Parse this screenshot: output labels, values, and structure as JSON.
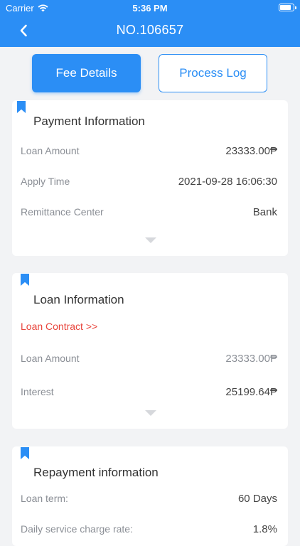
{
  "status_bar": {
    "carrier": "Carrier",
    "time": "5:36 PM"
  },
  "nav": {
    "title": "NO.106657"
  },
  "tabs": {
    "fee_details": "Fee Details",
    "process_log": "Process Log"
  },
  "payment_info": {
    "title": "Payment Information",
    "rows": [
      {
        "label": "Loan Amount",
        "value": "23333.00₱"
      },
      {
        "label": "Apply Time",
        "value": "2021-09-28 16:06:30"
      },
      {
        "label": "Remittance Center",
        "value": "Bank"
      }
    ]
  },
  "loan_info": {
    "title": "Loan Information",
    "contract_link": "Loan Contract  >>",
    "rows": [
      {
        "label": "Loan Amount",
        "value": "23333.00₱"
      },
      {
        "label": "Interest",
        "value": "25199.64₱"
      }
    ]
  },
  "repayment_info": {
    "title": "Repayment information",
    "rows": [
      {
        "label": "Loan term:",
        "value": "60 Days"
      },
      {
        "label": "Daily service charge rate:",
        "value": "1.8%"
      }
    ]
  },
  "colors": {
    "primary": "#2b8ef5",
    "link_red": "#e8453c",
    "background": "#f2f3f5"
  }
}
